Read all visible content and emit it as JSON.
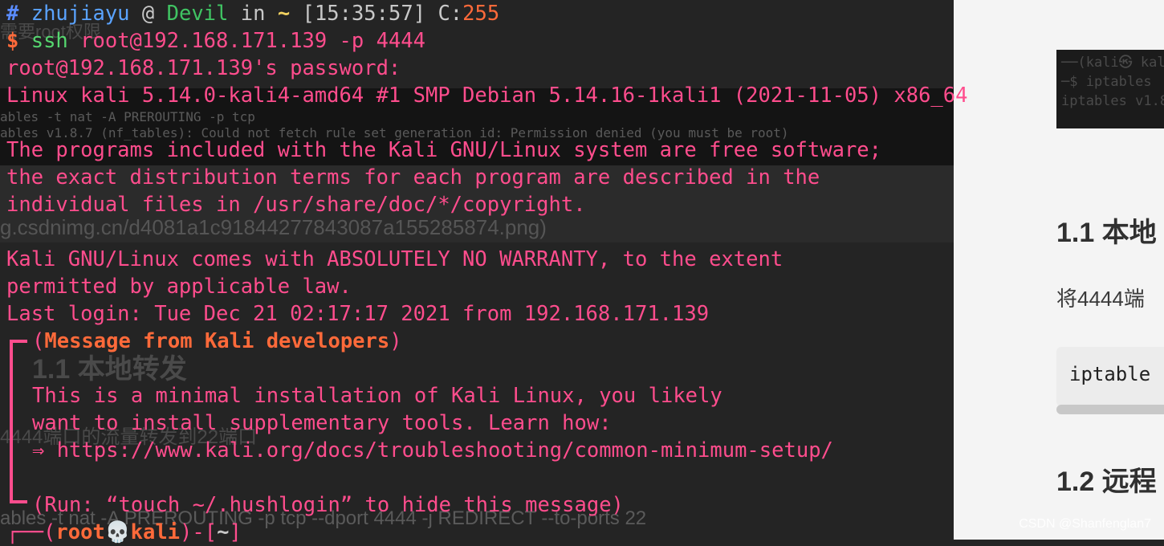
{
  "prompt": {
    "hash": "#",
    "user": "zhujiayu",
    "at": "@",
    "host": "Devil",
    "in": "in",
    "dir": "~",
    "time": "[15:35:57]",
    "code_label": "C:",
    "code_value": "255",
    "dollar": "$",
    "command": "ssh",
    "args": "root@192.168.171.139 -p 4444"
  },
  "output": {
    "password_prompt": "root@192.168.171.139's password:",
    "uname": "Linux kali 5.14.0-kali4-amd64 #1 SMP Debian 5.14.16-1kali1 (2021-11-05) x86_64",
    "free_sw_1": "The programs included with the Kali GNU/Linux system are free software;",
    "free_sw_2": "the exact distribution terms for each program are described in the",
    "free_sw_3": "individual files in /usr/share/doc/*/copyright.",
    "warranty_1": "Kali GNU/Linux comes with ABSOLUTELY NO WARRANTY, to the extent",
    "warranty_2": "permitted by applicable law.",
    "last_login": "Last login: Tue Dec 21 02:17:17 2021 from 192.168.171.139"
  },
  "message_box": {
    "header_open": "(",
    "header": "Message from Kali developers",
    "header_close": ")",
    "line_1": "This is a minimal installation of Kali Linux, you likely",
    "line_2": "want to install supplementary tools. Learn how:",
    "line_3": "⇒ https://www.kali.org/docs/troubleshooting/common-minimum-setup/",
    "footer": "(Run: “touch ~/.hushlogin” to hide this message)"
  },
  "kali_prompt": {
    "open": "┌──(",
    "user": "root",
    "skull": "💀",
    "host": "kali",
    "mid": ")-[",
    "dir": "~",
    "close": "]"
  },
  "background": {
    "ghost_1": "需要root权限",
    "ghost_2": "ables -t nat -A PREROUTING -p tcp",
    "ghost_3": "ables v1.8.7 (nf_tables): Could not fetch rule set generation id: Permission denied (you must be root)",
    "ghost_4": "g.csdnimg.cn/d4081a1c91844277843087a155285874.png)",
    "ghost_5": "1.1 本地转发",
    "ghost_6": "4444端口的流量转发到22端口",
    "ghost_7": "ables -t nat -A PREROUTING -p tcp --dport 4444 -j REDIRECT --to-ports 22",
    "article_code_1": "──(kali㉿ kali",
    "article_code_2": "─$ iptables",
    "article_code_3": "iptables v1.8",
    "article_h1": "1.1 本地",
    "article_p": "将4444端",
    "article_inline": "iptable",
    "article_h2": "1.2 远程",
    "watermark": "CSDN @Shanfenglan7"
  }
}
